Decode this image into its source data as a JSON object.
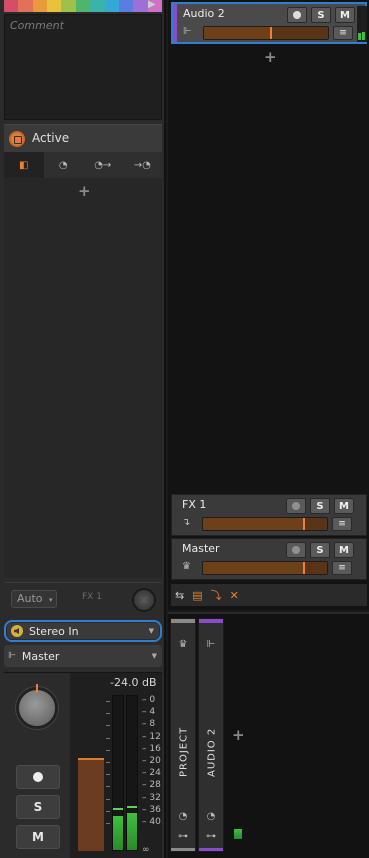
{
  "palette": [
    "#d44e6a",
    "#e0725a",
    "#e99a3a",
    "#e7c23c",
    "#9fc04a",
    "#4fb56a",
    "#3bb3a8",
    "#35a8d8",
    "#5a7ee0",
    "#9e6fd8",
    "#d070c8"
  ],
  "comment": {
    "placeholder": "Comment"
  },
  "device": {
    "title": "Active",
    "tabs": [
      "device-icon",
      "clock-icon",
      "clock-out-icon",
      "clock-in-icon"
    ],
    "add_label": "+"
  },
  "automation": {
    "mode": "Auto",
    "chevron": "▾",
    "send_label": "FX 1"
  },
  "io": {
    "input": "Stereo In",
    "output": "Master"
  },
  "mixer": {
    "volume_readout": "-24.0 dB",
    "fader_level_pct": 35,
    "meter_left": {
      "level_pct": 22,
      "peak_pct": 26
    },
    "meter_right": {
      "level_pct": 24,
      "peak_pct": 27
    },
    "scale": [
      "0",
      "4",
      "8",
      "12",
      "16",
      "20",
      "24",
      "28",
      "32",
      "36",
      "40",
      "∞"
    ],
    "buttons": {
      "solo": "S",
      "mute": "M"
    }
  },
  "tracks": {
    "audio2": {
      "name": "Audio 2",
      "level_pct": 55,
      "solo": "S",
      "mute": "M",
      "menu": "≡",
      "color": "#8a4acc"
    },
    "add_label": "+",
    "fx1": {
      "name": "FX 1",
      "level_pct": 82,
      "solo": "S",
      "mute": "M",
      "menu": "≡"
    },
    "master": {
      "name": "Master",
      "level_pct": 82,
      "solo": "S",
      "mute": "M",
      "menu": "≡"
    },
    "toolbar": [
      "⇆",
      "▤",
      "⤵",
      "✕"
    ]
  },
  "strips": {
    "project": {
      "label": "PROJECT",
      "color": "#8a8a8a"
    },
    "audio2": {
      "label": "AUDIO 2",
      "color": "#8a4acc"
    },
    "add_label": "+"
  }
}
